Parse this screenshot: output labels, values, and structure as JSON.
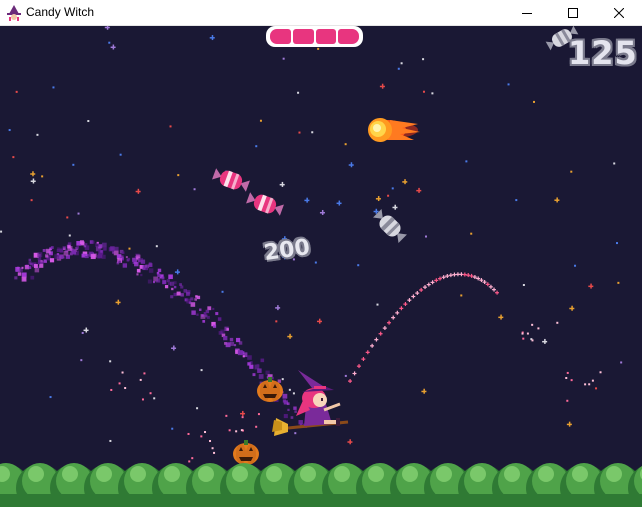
{
  "window": {
    "title": "Candy Witch",
    "controls": [
      "minimize-icon",
      "maximize-icon",
      "close-icon"
    ]
  },
  "hud": {
    "health_segments_filled": 4,
    "health_segments_total": 4,
    "score": "125",
    "score_icon": "silver-candy-icon"
  },
  "popup": {
    "points": "200"
  },
  "colors": {
    "sky": "#1a1834",
    "health": "#e8357f",
    "candy_pink": "#e8357f",
    "candy_silver": "#c8c8d2",
    "trail_purple": "#a43ad8",
    "bushes": "#4fa349",
    "fireball": "#ff8a1c"
  },
  "sprites": {
    "player": "witch-on-broom-icon",
    "enemy_projectile": "fireball-icon",
    "pickups": [
      "pink-candy-icon",
      "pink-candy-icon",
      "silver-candy-icon"
    ],
    "hazards": [
      "jack-o-lantern-icon",
      "jack-o-lantern-icon"
    ]
  }
}
